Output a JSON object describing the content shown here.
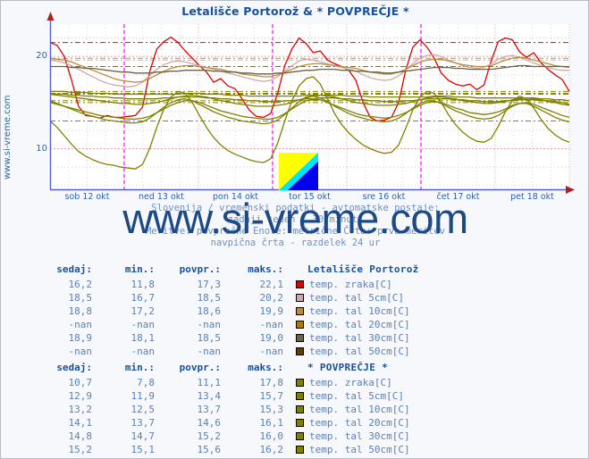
{
  "header": {
    "title": "Letališče Portorož & * POVPREČJE *"
  },
  "side_label": "www.si-vreme.com",
  "watermark": "www.si-vreme.com",
  "caption": {
    "line1": "Slovenija / vremenski podatki - avtomatske postaje:",
    "line2": "zadnji teden / 30 minut.",
    "line3": "Meritve: povprečne  Enote: metrične  Črta: prva meritev",
    "line4": "navpična črta - razdelek 24 ur"
  },
  "table_headers": {
    "sedaj": "sedaj:",
    "min": "min.:",
    "povpr": "povpr.:",
    "maks": "maks.:"
  },
  "tables": [
    {
      "station": "Letališče Portorož",
      "rows": [
        {
          "sedaj": "16,2",
          "min": "11,8",
          "povpr": "17,3",
          "maks": "22,1",
          "color": "#e00000",
          "name": "temp. zraka[C]"
        },
        {
          "sedaj": "18,5",
          "min": "16,7",
          "povpr": "18,5",
          "maks": "20,2",
          "color": "#cbaaaa",
          "name": "temp. tal  5cm[C]"
        },
        {
          "sedaj": "18,8",
          "min": "17,2",
          "povpr": "18,6",
          "maks": "19,9",
          "color": "#c08a38",
          "name": "temp. tal 10cm[C]"
        },
        {
          "sedaj": "-nan",
          "min": "-nan",
          "povpr": "-nan",
          "maks": "-nan",
          "color": "#a87c06",
          "name": "temp. tal 20cm[C]"
        },
        {
          "sedaj": "18,9",
          "min": "18,1",
          "povpr": "18,5",
          "maks": "19,0",
          "color": "#6b6345",
          "name": "temp. tal 30cm[C]"
        },
        {
          "sedaj": "-nan",
          "min": "-nan",
          "povpr": "-nan",
          "maks": "-nan",
          "color": "#5e3a0d",
          "name": "temp. tal 50cm[C]"
        }
      ]
    },
    {
      "station": "* POVPREČJE *",
      "rows": [
        {
          "sedaj": "10,7",
          "min": "7,8",
          "povpr": "11,1",
          "maks": "17,8",
          "color": "#808000",
          "name": "temp. zraka[C]"
        },
        {
          "sedaj": "12,9",
          "min": "11,9",
          "povpr": "13,4",
          "maks": "15,7",
          "color": "#808000",
          "name": "temp. tal  5cm[C]"
        },
        {
          "sedaj": "13,2",
          "min": "12,5",
          "povpr": "13,7",
          "maks": "15,3",
          "color": "#808000",
          "name": "temp. tal 10cm[C]"
        },
        {
          "sedaj": "14,1",
          "min": "13,7",
          "povpr": "14,6",
          "maks": "16,1",
          "color": "#808000",
          "name": "temp. tal 20cm[C]"
        },
        {
          "sedaj": "14,8",
          "min": "14,7",
          "povpr": "15,2",
          "maks": "16,0",
          "color": "#808000",
          "name": "temp. tal 30cm[C]"
        },
        {
          "sedaj": "15,2",
          "min": "15,1",
          "povpr": "15,6",
          "maks": "16,2",
          "color": "#808000",
          "name": "temp. tal 50cm[C]"
        }
      ]
    }
  ],
  "chart_data": {
    "type": "line",
    "title": "Letališče Portorož & * POVPREČJE *",
    "xlabel": "",
    "ylabel": "",
    "ylim": [
      5.5,
      23.5
    ],
    "yticks": [
      10,
      20
    ],
    "ytick_labels": [
      "10",
      "20"
    ],
    "grid": true,
    "legend_position": "below-table",
    "x_tick_labels": [
      "sob 12 okt",
      "ned 13 okt",
      "pon 14 okt",
      "tor 15 okt",
      "sre 16 okt",
      "čet 17 okt",
      "pet 18 okt"
    ],
    "x_day_separators": [
      "ned 13 okt",
      "tor 15 okt",
      "čet 17 okt"
    ],
    "series": [
      {
        "name": "Letališče Portorož temp. zraka[C]",
        "color": "#e00000",
        "values": [
          21.5,
          21.2,
          20.0,
          17.5,
          14.6,
          13.6,
          13.5,
          13.3,
          13.6,
          13.4,
          13.4,
          13.5,
          13.6,
          14.5,
          18.3,
          20.8,
          21.6,
          22.1,
          21.5,
          20.6,
          19.8,
          19.0,
          18.3,
          17.2,
          17.6,
          16.8,
          16.5,
          15.4,
          14.2,
          13.5,
          13.4,
          13.8,
          16.0,
          19.0,
          20.8,
          22.0,
          21.4,
          20.4,
          20.6,
          19.6,
          19.2,
          18.9,
          18.5,
          17.4,
          15.0,
          13.4,
          13.0,
          13.1,
          13.4,
          15.0,
          18.5,
          21.0,
          21.8,
          21.0,
          19.8,
          18.2,
          17.4,
          17.0,
          16.8,
          17.0,
          16.4,
          16.9,
          19.5,
          21.6,
          22.0,
          21.8,
          20.5,
          19.9,
          20.4,
          19.3,
          18.6,
          18.0,
          17.5,
          16.2
        ]
      },
      {
        "name": "Letališče Portorož temp. tal 5cm[C]",
        "color": "#cbaaaa",
        "values": [
          19.6,
          19.5,
          19.3,
          19.0,
          18.6,
          18.2,
          17.8,
          17.4,
          17.1,
          16.9,
          16.8,
          16.7,
          16.8,
          17.2,
          17.9,
          18.6,
          19.1,
          19.4,
          19.5,
          19.4,
          19.2,
          19.0,
          18.8,
          18.6,
          18.4,
          18.2,
          18.0,
          17.8,
          17.6,
          17.4,
          17.3,
          17.4,
          17.8,
          18.4,
          19.0,
          19.5,
          19.7,
          19.6,
          19.4,
          19.2,
          19.0,
          18.8,
          18.6,
          18.4,
          18.0,
          17.7,
          17.5,
          17.4,
          17.5,
          17.9,
          18.5,
          19.2,
          19.8,
          20.1,
          20.2,
          20.0,
          19.6,
          19.3,
          19.0,
          18.8,
          18.7,
          18.8,
          19.2,
          19.7,
          20.0,
          20.1,
          19.9,
          19.6,
          19.3,
          19.0,
          18.8,
          18.6,
          18.5,
          18.5
        ]
      },
      {
        "name": "Letališče Portorož temp. tal 10cm[C]",
        "color": "#c08a38",
        "values": [
          19.8,
          19.7,
          19.6,
          19.4,
          19.1,
          18.8,
          18.5,
          18.2,
          17.9,
          17.6,
          17.4,
          17.3,
          17.2,
          17.3,
          17.6,
          18.0,
          18.4,
          18.7,
          18.9,
          19.0,
          19.0,
          18.9,
          18.8,
          18.7,
          18.6,
          18.4,
          18.3,
          18.1,
          18.0,
          17.9,
          17.8,
          17.8,
          18.0,
          18.3,
          18.6,
          18.9,
          19.1,
          19.2,
          19.2,
          19.1,
          19.0,
          18.9,
          18.8,
          18.7,
          18.5,
          18.3,
          18.2,
          18.1,
          18.1,
          18.3,
          18.6,
          19.0,
          19.4,
          19.6,
          19.7,
          19.7,
          19.5,
          19.3,
          19.1,
          19.0,
          18.9,
          18.9,
          19.0,
          19.3,
          19.6,
          19.8,
          19.9,
          19.8,
          19.6,
          19.4,
          19.2,
          19.0,
          18.9,
          18.8
        ]
      },
      {
        "name": "Letališče Portorož temp. tal 30cm[C]",
        "color": "#6b6345",
        "values": [
          18.9,
          18.9,
          18.9,
          18.8,
          18.8,
          18.7,
          18.7,
          18.6,
          18.5,
          18.4,
          18.3,
          18.3,
          18.2,
          18.2,
          18.2,
          18.3,
          18.3,
          18.4,
          18.4,
          18.5,
          18.5,
          18.5,
          18.5,
          18.4,
          18.4,
          18.3,
          18.3,
          18.2,
          18.2,
          18.1,
          18.1,
          18.1,
          18.2,
          18.2,
          18.3,
          18.4,
          18.5,
          18.5,
          18.6,
          18.6,
          18.6,
          18.5,
          18.5,
          18.4,
          18.4,
          18.3,
          18.3,
          18.2,
          18.2,
          18.3,
          18.4,
          18.5,
          18.6,
          18.7,
          18.8,
          18.8,
          18.8,
          18.7,
          18.7,
          18.6,
          18.6,
          18.6,
          18.6,
          18.7,
          18.8,
          18.9,
          19.0,
          19.0,
          18.9,
          18.9,
          18.9,
          18.9,
          18.9,
          18.9
        ]
      },
      {
        "name": "* POVPREČJE * temp. zraka[C]",
        "color": "#808000",
        "values": [
          13.0,
          12.3,
          11.4,
          10.5,
          9.7,
          9.2,
          8.8,
          8.5,
          8.3,
          8.2,
          8.0,
          7.9,
          7.8,
          8.3,
          10.0,
          12.3,
          14.3,
          15.6,
          16.2,
          16.0,
          15.0,
          13.6,
          12.3,
          11.2,
          10.4,
          9.8,
          9.4,
          9.1,
          8.8,
          8.6,
          8.5,
          8.9,
          10.6,
          13.0,
          15.2,
          16.8,
          17.6,
          17.8,
          17.0,
          15.4,
          13.8,
          12.6,
          11.7,
          11.0,
          10.4,
          10.0,
          9.7,
          9.5,
          9.6,
          10.4,
          12.2,
          14.2,
          15.6,
          16.2,
          16.0,
          15.0,
          13.7,
          12.6,
          11.8,
          11.2,
          10.8,
          10.7,
          11.1,
          12.4,
          14.0,
          15.2,
          15.7,
          15.4,
          14.4,
          13.2,
          12.2,
          11.5,
          11.0,
          10.7
        ]
      },
      {
        "name": "* POVPREČJE * temp. tal 5cm[C]",
        "color": "#808000",
        "values": [
          15.2,
          14.9,
          14.6,
          14.3,
          14.0,
          13.7,
          13.5,
          13.3,
          13.1,
          13.0,
          12.9,
          12.8,
          12.8,
          12.9,
          13.3,
          13.9,
          14.5,
          15.0,
          15.3,
          15.4,
          15.2,
          14.8,
          14.4,
          14.0,
          13.7,
          13.4,
          13.2,
          13.0,
          12.9,
          12.8,
          12.7,
          12.8,
          13.1,
          13.7,
          14.4,
          15.1,
          15.6,
          15.7,
          15.5,
          15.1,
          14.6,
          14.2,
          13.8,
          13.5,
          13.3,
          13.1,
          13.0,
          12.9,
          13.0,
          13.3,
          13.8,
          14.4,
          14.9,
          15.2,
          15.2,
          14.9,
          14.5,
          14.1,
          13.8,
          13.5,
          13.3,
          13.2,
          13.3,
          13.6,
          14.1,
          14.6,
          14.9,
          14.9,
          14.6,
          14.2,
          13.8,
          13.4,
          13.1,
          12.9
        ]
      },
      {
        "name": "* POVPREČJE * temp. tal 10cm[C]",
        "color": "#808000",
        "values": [
          15.0,
          14.8,
          14.6,
          14.4,
          14.2,
          14.0,
          13.8,
          13.6,
          13.5,
          13.4,
          13.3,
          13.2,
          13.2,
          13.3,
          13.5,
          13.9,
          14.3,
          14.7,
          15.0,
          15.2,
          15.2,
          15.0,
          14.7,
          14.4,
          14.1,
          13.9,
          13.7,
          13.5,
          13.4,
          13.3,
          13.2,
          13.2,
          13.4,
          13.8,
          14.3,
          14.8,
          15.2,
          15.3,
          15.3,
          15.0,
          14.7,
          14.4,
          14.1,
          13.8,
          13.6,
          13.5,
          13.4,
          13.3,
          13.4,
          13.6,
          13.9,
          14.3,
          14.7,
          15.0,
          15.1,
          15.0,
          14.7,
          14.4,
          14.2,
          13.9,
          13.8,
          13.7,
          13.8,
          14.0,
          14.3,
          14.7,
          14.9,
          15.0,
          14.8,
          14.5,
          14.2,
          13.9,
          13.6,
          13.4
        ]
      },
      {
        "name": "* POVPREČJE * temp. tal 20cm[C]",
        "color": "#808000",
        "values": [
          15.9,
          15.8,
          15.7,
          15.6,
          15.5,
          15.4,
          15.3,
          15.2,
          15.1,
          15.0,
          14.9,
          14.9,
          14.8,
          14.8,
          14.9,
          15.0,
          15.2,
          15.4,
          15.6,
          15.7,
          15.8,
          15.7,
          15.6,
          15.4,
          15.2,
          15.1,
          14.9,
          14.8,
          14.7,
          14.6,
          14.6,
          14.6,
          14.7,
          14.8,
          15.0,
          15.3,
          15.5,
          15.7,
          15.8,
          15.7,
          15.6,
          15.4,
          15.2,
          15.0,
          14.9,
          14.8,
          14.7,
          14.7,
          14.7,
          14.8,
          14.9,
          15.1,
          15.3,
          15.5,
          15.6,
          15.6,
          15.5,
          15.4,
          15.2,
          15.1,
          15.0,
          14.9,
          14.9,
          15.0,
          15.1,
          15.3,
          15.4,
          15.5,
          15.4,
          15.3,
          15.1,
          15.0,
          14.8,
          14.7
        ]
      },
      {
        "name": "* POVPREČJE * temp. tal 30cm[C]",
        "color": "#808000",
        "values": [
          16.0,
          15.9,
          15.9,
          15.8,
          15.8,
          15.7,
          15.7,
          15.6,
          15.6,
          15.5,
          15.5,
          15.4,
          15.4,
          15.4,
          15.4,
          15.4,
          15.5,
          15.5,
          15.6,
          15.6,
          15.6,
          15.6,
          15.5,
          15.5,
          15.4,
          15.4,
          15.3,
          15.3,
          15.2,
          15.2,
          15.1,
          15.1,
          15.1,
          15.2,
          15.2,
          15.3,
          15.4,
          15.4,
          15.5,
          15.5,
          15.5,
          15.4,
          15.4,
          15.3,
          15.3,
          15.2,
          15.2,
          15.1,
          15.1,
          15.1,
          15.2,
          15.2,
          15.3,
          15.4,
          15.4,
          15.4,
          15.4,
          15.3,
          15.3,
          15.2,
          15.2,
          15.1,
          15.1,
          15.1,
          15.2,
          15.2,
          15.3,
          15.3,
          15.3,
          15.2,
          15.2,
          15.1,
          15.0,
          14.8
        ]
      },
      {
        "name": "* POVPREČJE * temp. tal 50cm[C]",
        "color": "#808000",
        "values": [
          16.2,
          16.2,
          16.2,
          16.1,
          16.1,
          16.1,
          16.0,
          16.0,
          16.0,
          15.9,
          15.9,
          15.9,
          15.9,
          15.9,
          15.9,
          15.9,
          15.9,
          15.9,
          15.9,
          16.0,
          16.0,
          16.0,
          15.9,
          15.9,
          15.9,
          15.8,
          15.8,
          15.8,
          15.7,
          15.7,
          15.7,
          15.7,
          15.7,
          15.7,
          15.7,
          15.7,
          15.8,
          15.8,
          15.8,
          15.8,
          15.8,
          15.8,
          15.7,
          15.7,
          15.7,
          15.6,
          15.6,
          15.6,
          15.6,
          15.6,
          15.6,
          15.6,
          15.6,
          15.6,
          15.7,
          15.7,
          15.7,
          15.6,
          15.6,
          15.6,
          15.5,
          15.5,
          15.5,
          15.5,
          15.5,
          15.5,
          15.5,
          15.5,
          15.5,
          15.4,
          15.4,
          15.3,
          15.3,
          15.2
        ]
      }
    ]
  }
}
